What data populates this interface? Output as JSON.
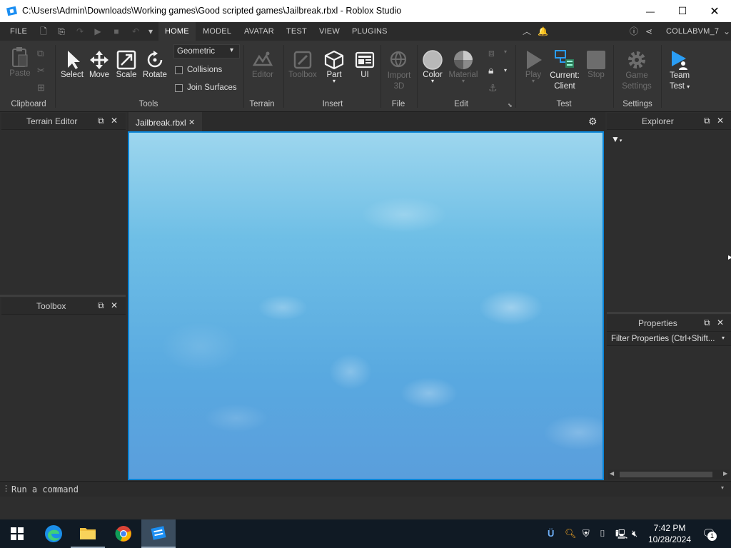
{
  "window": {
    "title": "C:\\Users\\Admin\\Downloads\\Working games\\Good scripted games\\Jailbreak.rbxl - Roblox Studio",
    "minimize": "—",
    "maximize": "☐",
    "close": "✕"
  },
  "menu": {
    "file": "FILE",
    "tabs": [
      "HOME",
      "MODEL",
      "AVATAR",
      "TEST",
      "VIEW",
      "PLUGINS"
    ],
    "active_tab": "HOME",
    "user": "COLLABVM_7"
  },
  "ribbon": {
    "clipboard": {
      "paste": "Paste",
      "group": "Clipboard"
    },
    "tools": {
      "select": "Select",
      "move": "Move",
      "scale": "Scale",
      "rotate": "Rotate",
      "group": "Tools",
      "mode_dropdown": "Geometric",
      "collisions": "Collisions",
      "join_surfaces": "Join Surfaces"
    },
    "terrain": {
      "editor": "Editor",
      "group": "Terrain"
    },
    "insert": {
      "toolbox": "Toolbox",
      "part": "Part",
      "ui": "UI",
      "group": "Insert"
    },
    "file": {
      "import_3d_line1": "Import",
      "import_3d_line2": "3D",
      "group": "File"
    },
    "edit": {
      "color": "Color",
      "material": "Material",
      "group": "Edit"
    },
    "test": {
      "play": "Play",
      "current_line1": "Current:",
      "current_line2": "Client",
      "stop": "Stop",
      "group": "Test"
    },
    "settings": {
      "game_line1": "Game",
      "game_line2": "Settings",
      "group": "Settings"
    },
    "team_test": {
      "line1": "Team",
      "line2": "Test"
    }
  },
  "panels": {
    "terrain_editor": "Terrain Editor",
    "toolbox": "Toolbox",
    "explorer": "Explorer",
    "properties": "Properties",
    "filter_properties": "Filter Properties (Ctrl+Shift..."
  },
  "document": {
    "tab": "Jailbreak.rbxl"
  },
  "command_bar": {
    "placeholder": "Run a command"
  },
  "taskbar": {
    "time": "7:42 PM",
    "date": "10/28/2024",
    "notification_count": "1"
  },
  "colors": {
    "accent": "#0a84d6",
    "panel": "#2e2e2e",
    "ribbon": "#353535",
    "taskbar": "#101a24"
  }
}
